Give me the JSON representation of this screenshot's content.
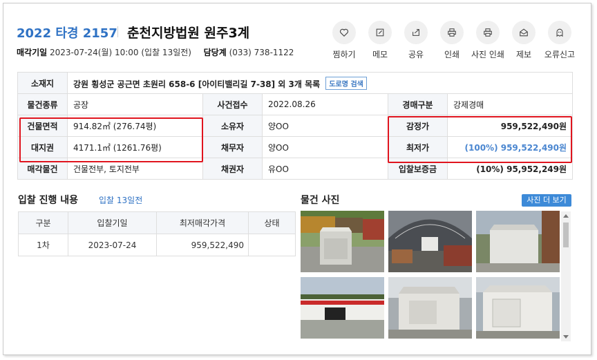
{
  "header": {
    "case_number": "2022 타경 2157",
    "court": "춘천지방법원 원주3계",
    "sale_date_label": "매각기일",
    "sale_date_value": "2023-07-24(월) 10:00 (입찰 13일전)",
    "dept_label": "담당계",
    "dept_phone": "(033) 738-1122"
  },
  "actions": [
    {
      "label": "찜하기",
      "icon": "heart-icon"
    },
    {
      "label": "메모",
      "icon": "pencil-icon"
    },
    {
      "label": "공유",
      "icon": "share-icon"
    },
    {
      "label": "인쇄",
      "icon": "printer-icon"
    },
    {
      "label": "사진 인쇄",
      "icon": "printer-icon"
    },
    {
      "label": "제보",
      "icon": "envelope-icon"
    },
    {
      "label": "오류신고",
      "icon": "ghost-icon"
    }
  ],
  "info": {
    "address_label": "소재지",
    "address_value": "강원 횡성군 공근면 초원리 658-6 [아이티밸리길 7-38] 외 3개 목록",
    "road_button": "도로명 검색",
    "type_label": "물건종류",
    "type_value": "공장",
    "received_label": "사건접수",
    "received_value": "2022.08.26",
    "auction_type_label": "경매구분",
    "auction_type_value": "강제경매",
    "building_area_label": "건물면적",
    "building_area_value": "914.82㎡ (276.74평)",
    "owner_label": "소유자",
    "owner_value": "양OO",
    "appraisal_label": "감정가",
    "appraisal_value": "959,522,490원",
    "land_right_label": "대지권",
    "land_right_value": "4171.1㎡ (1261.76평)",
    "debtor_label": "채무자",
    "debtor_value": "양OO",
    "min_price_label": "최저가",
    "min_price_value": "(100%) 959,522,490원",
    "sale_item_label": "매각물건",
    "sale_item_value": "건물전부, 토지전부",
    "creditor_label": "채권자",
    "creditor_value": "유OO",
    "deposit_label": "입찰보증금",
    "deposit_value": "(10%) 95,952,249원"
  },
  "bidding": {
    "title": "입찰 진행 내용",
    "subtitle": "입찰 13일전",
    "columns": [
      "구분",
      "입찰기일",
      "최저매각가격",
      "상태"
    ],
    "rows": [
      [
        "1차",
        "2023-07-24",
        "959,522,490",
        ""
      ]
    ]
  },
  "photos": {
    "title": "물건 사진",
    "more_button": "사진 더 보기"
  },
  "colors": {
    "accent_blue": "#2f72c4",
    "highlight_red": "#e0141e",
    "header_bg": "#f4f6f9"
  }
}
